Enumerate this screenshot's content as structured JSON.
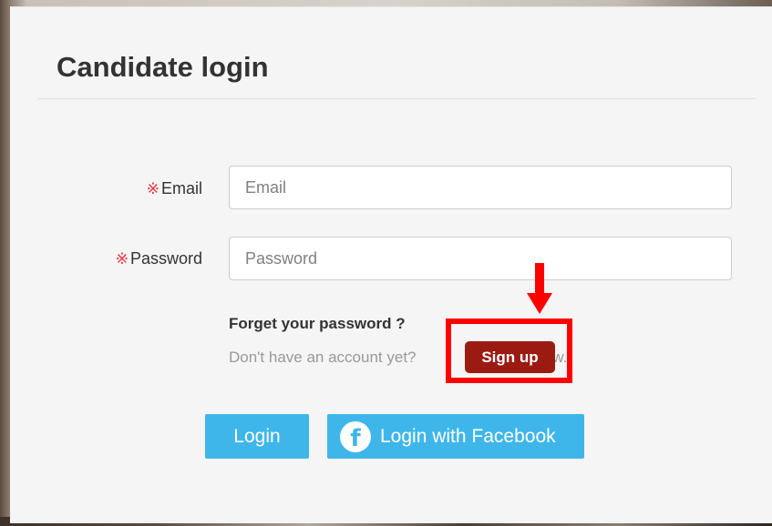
{
  "dialog": {
    "title": "Candidate login"
  },
  "form": {
    "required_mark": "※",
    "email": {
      "label": "Email",
      "placeholder": "Email",
      "value": ""
    },
    "password": {
      "label": "Password",
      "placeholder": "Password",
      "value": ""
    }
  },
  "links": {
    "forget_password": "Forget your password ?",
    "no_account_prefix": "Don't have an account yet?",
    "no_account_suffix": "Now.",
    "sign_up": "Sign up"
  },
  "actions": {
    "login": "Login",
    "login_facebook": "Login with Facebook",
    "facebook_icon_glyph": "f"
  },
  "annotation": {
    "color": "#ff0000",
    "arrow_icon": "down-arrow-icon"
  },
  "colors": {
    "primary_button": "#3fb6ea",
    "sign_up_button": "#9b1b12",
    "required_mark": "#e8353b"
  }
}
